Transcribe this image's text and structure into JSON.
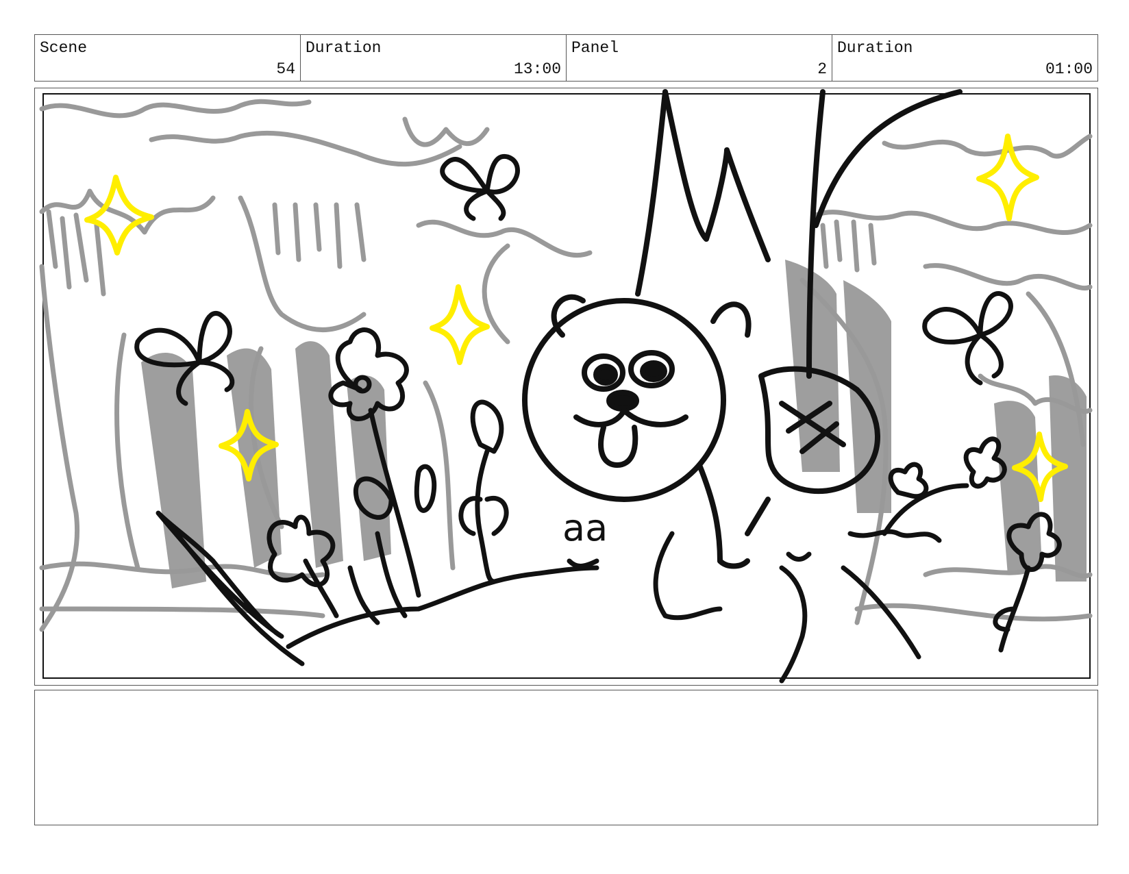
{
  "header": {
    "fields": [
      {
        "label": "Scene",
        "value": "54"
      },
      {
        "label": "Duration",
        "value": "13:00"
      },
      {
        "label": "Panel",
        "value": "2"
      },
      {
        "label": "Duration",
        "value": "01:00"
      }
    ]
  },
  "panel": {
    "sketch_note": "aa"
  },
  "notes": {
    "text": ""
  },
  "colors": {
    "line": "#111111",
    "background_sketch": "#999999",
    "sparkle": "#ffee00"
  }
}
